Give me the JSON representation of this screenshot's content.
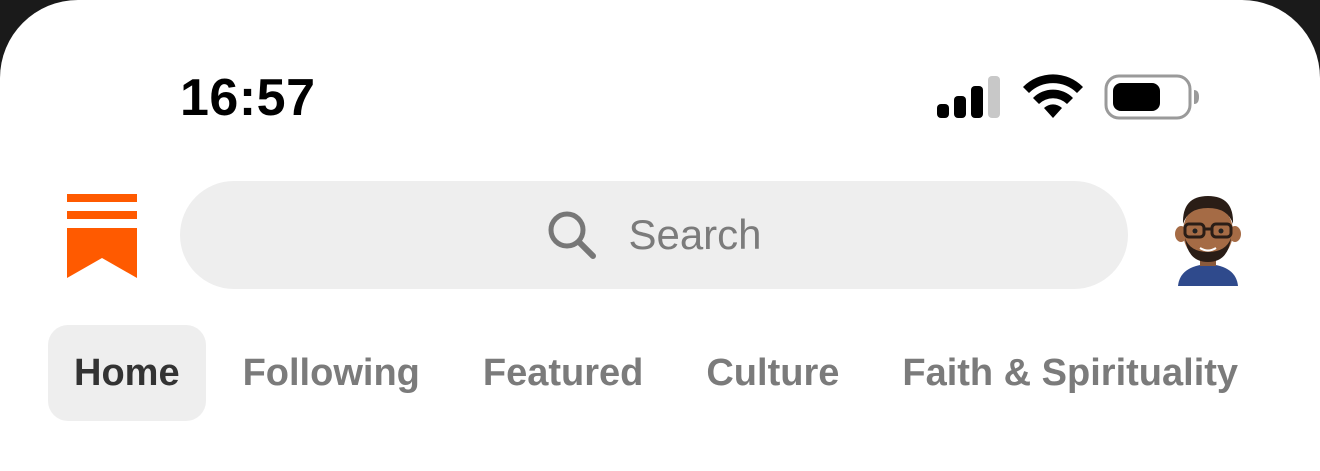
{
  "status_bar": {
    "time": "16:57",
    "icons": [
      "cellular-signal-icon",
      "wifi-icon",
      "battery-icon"
    ]
  },
  "header": {
    "logo_icon": "substack-bookmark-logo",
    "brand_color": "#ff5a00",
    "search": {
      "placeholder": "Search",
      "icon": "search-icon"
    },
    "avatar_icon": "memoji-avatar"
  },
  "tabs": [
    {
      "label": "Home",
      "active": true
    },
    {
      "label": "Following",
      "active": false
    },
    {
      "label": "Featured",
      "active": false
    },
    {
      "label": "Culture",
      "active": false
    },
    {
      "label": "Faith & Spirituality",
      "active": false
    }
  ]
}
